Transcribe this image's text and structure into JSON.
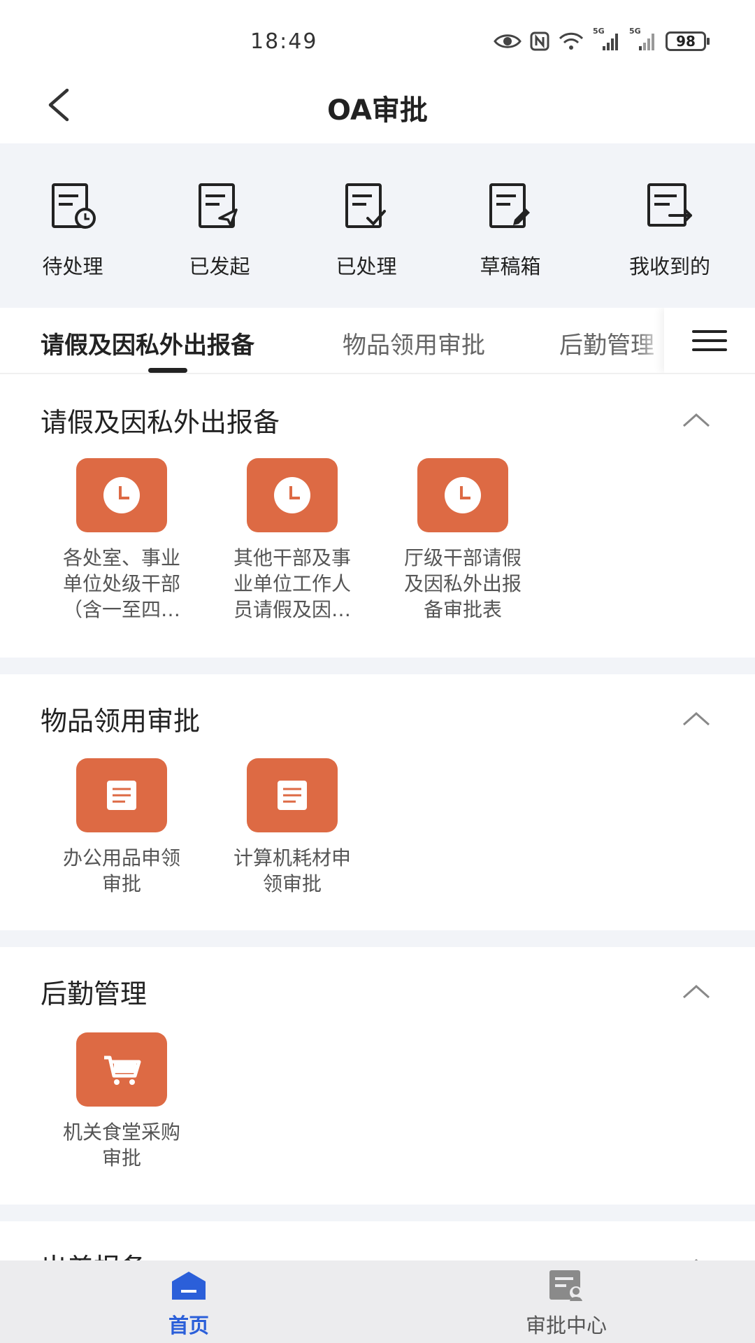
{
  "status": {
    "time": "18:49",
    "battery": "98",
    "net1": "5G",
    "net2": "5G"
  },
  "header": {
    "title": "OA审批"
  },
  "quick_actions": [
    {
      "label": "待处理",
      "icon": "pending-doc-icon"
    },
    {
      "label": "已发起",
      "icon": "sent-doc-icon"
    },
    {
      "label": "已处理",
      "icon": "done-doc-icon"
    },
    {
      "label": "草稿箱",
      "icon": "draft-doc-icon"
    },
    {
      "label": "我收到的",
      "icon": "received-doc-icon"
    }
  ],
  "tabs": [
    {
      "label": "请假及因私外出报备",
      "active": true
    },
    {
      "label": "物品领用审批",
      "active": false
    },
    {
      "label": "后勤管理",
      "active": false
    }
  ],
  "sections": [
    {
      "title": "请假及因私外出报备",
      "apps": [
        {
          "label_lines": [
            "各处室、事业",
            "单位处级干部",
            "（含一至四…"
          ],
          "icon": "clock-icon"
        },
        {
          "label_lines": [
            "其他干部及事",
            "业单位工作人",
            "员请假及因…"
          ],
          "icon": "clock-icon"
        },
        {
          "label_lines": [
            "厅级干部请假",
            "及因私外出报",
            "备审批表"
          ],
          "icon": "clock-icon"
        }
      ]
    },
    {
      "title": "物品领用审批",
      "apps": [
        {
          "label_lines": [
            "办公用品申领",
            "审批"
          ],
          "icon": "document-icon"
        },
        {
          "label_lines": [
            "计算机耗材申",
            "领审批"
          ],
          "icon": "document-icon"
        }
      ]
    },
    {
      "title": "后勤管理",
      "apps": [
        {
          "label_lines": [
            "机关食堂采购",
            "审批"
          ],
          "icon": "cart-icon"
        }
      ]
    },
    {
      "title": "出差报备",
      "apps": []
    }
  ],
  "bottom_nav": [
    {
      "label": "首页",
      "active": true,
      "icon": "home-icon"
    },
    {
      "label": "审批中心",
      "active": false,
      "icon": "approval-center-icon"
    }
  ],
  "colors": {
    "accent": "#2b5fd9",
    "app_icon_bg": "#dd6a44",
    "section_gap": "#f2f4f8",
    "nav_bg": "#ececee"
  }
}
